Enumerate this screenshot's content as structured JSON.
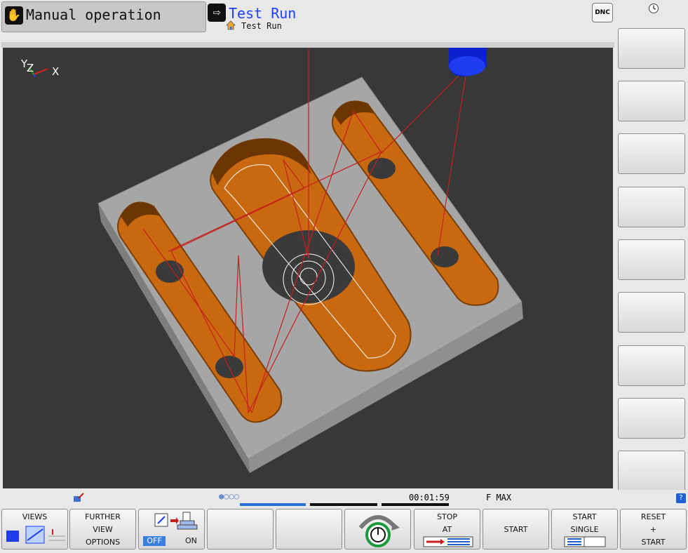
{
  "header": {
    "manual_label": "Manual operation",
    "test_label": "Test Run",
    "program_name": "Test Run",
    "dnc_label": "DNC"
  },
  "viewport": {
    "axis_y": "Y",
    "axis_z": "Z",
    "axis_x": "X"
  },
  "status": {
    "run_time": "00:01:59",
    "feed": "F MAX"
  },
  "softkeys": {
    "views": "VIEWS",
    "further_1": "FURTHER",
    "further_2": "VIEW",
    "further_3": "OPTIONS",
    "toggle_off": "OFF",
    "toggle_on": "ON",
    "stop_1": "STOP",
    "stop_2": "AT",
    "start": "START",
    "start_single_1": "START",
    "start_single_2": "SINGLE",
    "reset_1": "RESET",
    "reset_2": "+",
    "reset_3": "START"
  },
  "colors": {
    "pocket_orange": "#c8690f",
    "block_gray": "#a6a6a6",
    "tool_blue": "#0a22cc",
    "path_red": "#c81e1e",
    "mode_title_blue": "#1d3fff"
  },
  "icons": [
    "hand-icon",
    "run-arrow-icon",
    "home-icon",
    "clock-icon",
    "help-icon"
  ]
}
